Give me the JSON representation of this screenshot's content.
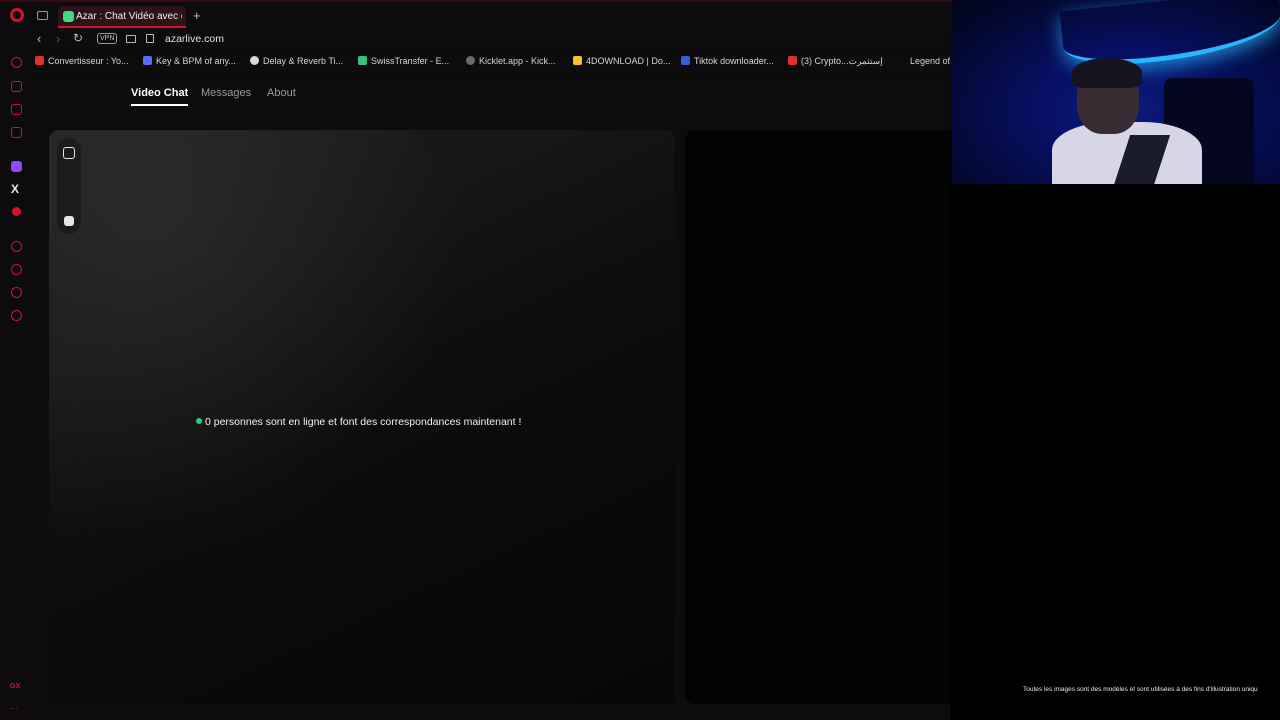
{
  "browser": {
    "tab_title": "Azar : Chat Vidéo avec de",
    "new_tab": "+",
    "vpn_label": "VPN",
    "url": "azarlive.com",
    "accent_color": "#d0142e"
  },
  "bookmarks": [
    {
      "label": "Convertisseur : Yo...",
      "icon_color": "#e03131"
    },
    {
      "label": "Key & BPM of any...",
      "icon_color": "#5b6cff"
    },
    {
      "label": "Delay & Reverb Ti...",
      "icon_color": "#d9d9d9"
    },
    {
      "label": "SwissTransfer - E...",
      "icon_color": "#34c27a"
    },
    {
      "label": "Kicklet.app - Kick...",
      "icon_color": "#6c6c6c"
    },
    {
      "label": "4DOWNLOAD | Do...",
      "icon_color": "#f2c230"
    },
    {
      "label": "Tiktok downloader...",
      "icon_color": "#3b5bdb"
    },
    {
      "label": "(3) Crypto...إستثمرت",
      "icon_color": "#e03131"
    },
    {
      "label": "Legend of",
      "icon_color": ""
    }
  ],
  "sidebar": {
    "gx_label": "GX",
    "more_label": "..."
  },
  "nav": {
    "video_chat": "Video Chat",
    "messages": "Messages",
    "about": "About"
  },
  "main": {
    "online_status": "0 personnes sont en ligne et font des correspondances maintenant !",
    "status_color": "#22d17a"
  },
  "footer": {
    "disclaimer": "Toutes les images sont des modèles et sont utilisées à des fins d'illustration uniqu"
  }
}
